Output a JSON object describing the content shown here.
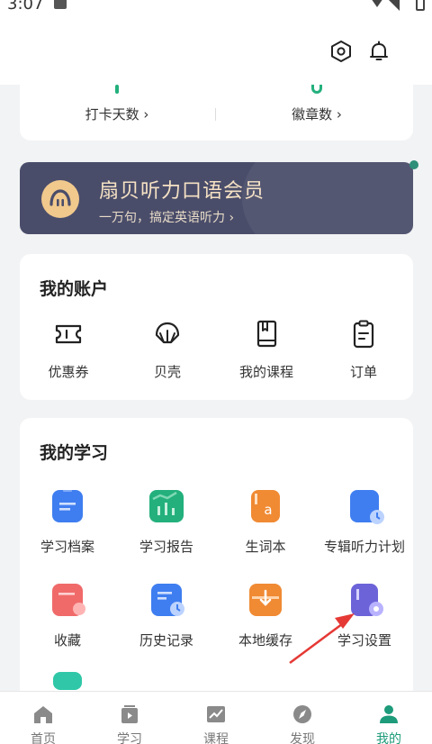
{
  "status_bar": {
    "time": "3:07"
  },
  "stats": [
    {
      "label": "打卡天数"
    },
    {
      "label": "徽章数"
    }
  ],
  "vip": {
    "title": "扇贝听力口语会员",
    "subtitle": "一万句，搞定英语听力"
  },
  "account": {
    "title": "我的账户",
    "items": [
      {
        "label": "优惠券",
        "icon": "coupon-icon"
      },
      {
        "label": "贝壳",
        "icon": "shell-icon"
      },
      {
        "label": "我的课程",
        "icon": "book-icon"
      },
      {
        "label": "订单",
        "icon": "clipboard-icon"
      }
    ]
  },
  "study": {
    "title": "我的学习",
    "items": [
      {
        "label": "学习档案",
        "icon": "study-archive-icon",
        "color": "#3f7ef0"
      },
      {
        "label": "学习报告",
        "icon": "study-report-icon",
        "color": "#23b07d"
      },
      {
        "label": "生词本",
        "icon": "vocabulary-icon",
        "color": "#f08a33"
      },
      {
        "label": "专辑听力计划",
        "icon": "listening-plan-icon",
        "color": "#3f7ef0"
      },
      {
        "label": "收藏",
        "icon": "favorites-icon",
        "color": "#f06a6a"
      },
      {
        "label": "历史记录",
        "icon": "history-icon",
        "color": "#3f7ef0"
      },
      {
        "label": "本地缓存",
        "icon": "local-cache-icon",
        "color": "#f08a33"
      },
      {
        "label": "学习设置",
        "icon": "study-settings-icon",
        "color": "#6c63d9"
      }
    ]
  },
  "nav": {
    "items": [
      {
        "label": "首页",
        "icon": "home-icon"
      },
      {
        "label": "学习",
        "icon": "study-icon"
      },
      {
        "label": "课程",
        "icon": "course-icon"
      },
      {
        "label": "发现",
        "icon": "discover-icon"
      },
      {
        "label": "我的",
        "icon": "profile-icon"
      }
    ],
    "active": "我的"
  },
  "colors": {
    "accent": "#1d9b7a",
    "vip_bg": "#4a4d6a",
    "arrow": "#e53935"
  }
}
